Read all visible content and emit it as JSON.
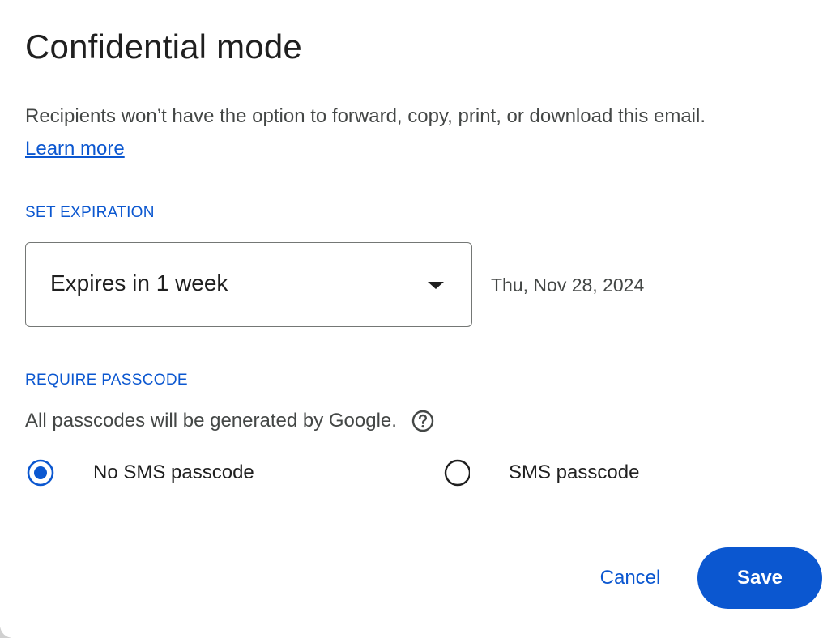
{
  "dialog": {
    "title": "Confidential mode",
    "description": "Recipients won’t have the option to forward, copy, print, or download this email.",
    "learn_more": "Learn more"
  },
  "expiration": {
    "section_label": "SET EXPIRATION",
    "selected_option": "Expires in 1 week",
    "date": "Thu, Nov 28, 2024",
    "dropdown_icon": "arrow-drop-down-icon"
  },
  "passcode": {
    "section_label": "REQUIRE PASSCODE",
    "note": "All passcodes will be generated by Google.",
    "help_icon": "help-circle-icon",
    "options": [
      {
        "label": "No SMS passcode",
        "selected": true
      },
      {
        "label": "SMS passcode",
        "selected": false
      }
    ]
  },
  "actions": {
    "cancel_label": "Cancel",
    "save_label": "Save"
  },
  "colors": {
    "accent": "#0b57d0",
    "title_text": "#1f1f1f",
    "body_text": "#444746",
    "border": "#747775"
  }
}
